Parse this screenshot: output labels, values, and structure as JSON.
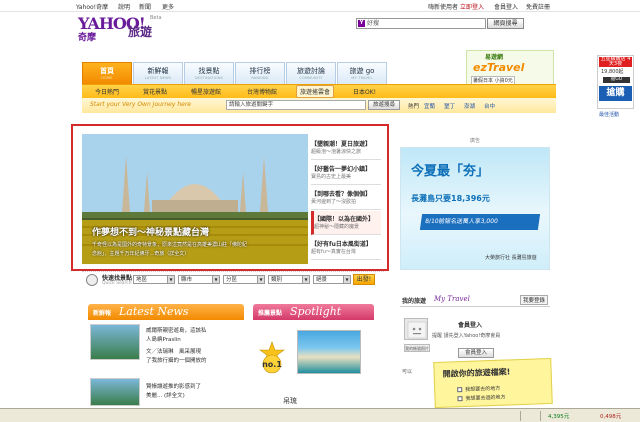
{
  "topbar": {
    "home": "Yahoo!奇摩",
    "help": "說明",
    "news": "新聞",
    "more": "更多",
    "greeting": "嗨新使用者",
    "signin": "立即登入",
    "member": "會員登入",
    "signup": "免費註冊"
  },
  "header": {
    "logo": "YAHOO!",
    "logo_sub": "奇摩",
    "section": "旅遊",
    "beta": "Beta",
    "search_placeholder": "好搜",
    "search_button": "網頁搜尋",
    "search_icon_letter": "Y"
  },
  "nav": {
    "tabs": [
      {
        "label": "首頁",
        "sub": "HOME",
        "active": true
      },
      {
        "label": "新鮮報",
        "sub": "LATEST NEWS",
        "active": false
      },
      {
        "label": "找景點",
        "sub": "DESTINATIONS",
        "active": false
      },
      {
        "label": "排行榜",
        "sub": "RANKING",
        "active": false
      },
      {
        "label": "旅遊討論",
        "sub": "COMMUNITY",
        "active": false
      },
      {
        "label": "旅遊 go",
        "sub": "MY TRAVEL",
        "active": false
      }
    ]
  },
  "promo_ez": {
    "brand": "易遊網",
    "logo": "ezTravel",
    "price": "暑假日本 小資0元"
  },
  "far_ad": {
    "title": "五星級飯店 4天3夜",
    "price": "19,800起",
    "badge": "搶GO",
    "big": "搶購",
    "link": "最佳活動"
  },
  "subnav": {
    "items": [
      {
        "label": "今日熱門",
        "active": false
      },
      {
        "label": "賞花景點",
        "active": false
      },
      {
        "label": "暢星旅遊館",
        "active": false
      },
      {
        "label": "台灣博物館",
        "active": false
      },
      {
        "label": "旅遊搖雲會",
        "active": true
      },
      {
        "label": "日本OK!",
        "active": false
      }
    ]
  },
  "searchbar": {
    "hint": "Start your Very Own Journey here",
    "placeholder": "請輸入旅遊關鍵字",
    "button": "旅遊搜尋",
    "hot_label": "熱門",
    "hot_links": [
      "宜蘭",
      "墾丁",
      "澎湖",
      "台中"
    ]
  },
  "feature": {
    "title": "作夢想不到～神秘景點藏台灣",
    "desc1": "千奇怪以為是國外的奇特景象，原來這竟然是在高雄美濃山莊「佛陀紀",
    "desc2": "念館」，主題千万年紀佛牙...奇旅（詳全文）",
    "items": [
      {
        "head": "【墾親潮！夏日旅遊】",
        "sub": "超級泡～泡暑涼快之旅"
      },
      {
        "head": "【好藝告一夢幻小鎮】",
        "sub": "寶島的古史上最美"
      },
      {
        "head": "【到哪去看？像個個】",
        "sub": "黃河邊到了～沒歐拍"
      },
      {
        "head": "【國際！以為在國外】",
        "sub": "超神秘～隱藏的魔景"
      },
      {
        "head": "【好有fu日本風街道】",
        "sub": "超有fu～真實在台灣"
      }
    ],
    "selected": 3
  },
  "ad": {
    "header": "廣告",
    "headline": "今夏最「夯」",
    "price_line": "長灘島只要18,396元",
    "strip": "8/10前報名送萬人享3,000",
    "footer": "大榮旅行社 長灘島旅遊"
  },
  "quicksearch": {
    "label": "快速找景點",
    "sub": "Quick Search",
    "selects": [
      "地區",
      "縣市",
      "分區",
      "類別",
      "絕景"
    ],
    "button": "出發!"
  },
  "news": {
    "badge": "新鮮報",
    "title": "Latest News",
    "items": [
      {
        "line1": "威爾斯親密遊島，這該私",
        "line2": "人島嶼Praslin"
      },
      {
        "line1": "文／法瑞琳　風采展現",
        "line2": "了我旅行攝的一個開放的"
      },
      {
        "line1": "賢帳讓遊推的影感到了",
        "line2": "美麗... (詳全文)"
      }
    ]
  },
  "spotlight": {
    "badge": "推薦景點",
    "title": "Spotlight",
    "rank": "no.1",
    "caption": "帛琉"
  },
  "mytravel": {
    "label": "我的旅遊",
    "brand": "My Travel",
    "button": "我要登錄",
    "login_title": "會員登入",
    "login_sub": "提醒 請先登入Yahoo!奇摩會員",
    "avatar_caption": "我的帳號照片",
    "login_btn": "會員登入",
    "note_title": "開啟你的旅遊檔案!",
    "note_line1": "我想要去的地方",
    "note_line2": "我想要去過的地方",
    "side_label": "可以"
  },
  "status": {
    "a": "4,395元",
    "b": "0,498元"
  },
  "colors": {
    "accent_orange": "#f28a00",
    "highlight_red": "#d42a2a",
    "brand_purple": "#6a1b9a"
  }
}
